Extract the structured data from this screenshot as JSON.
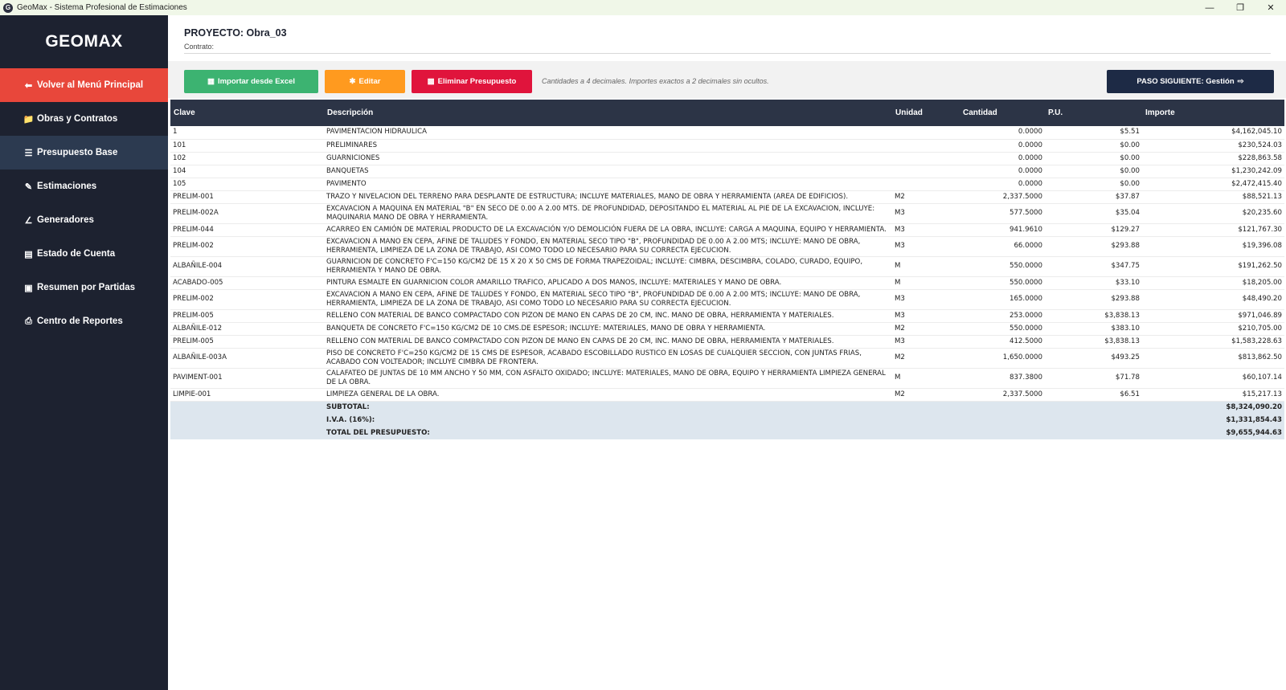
{
  "window": {
    "title": "GeoMax - Sistema Profesional de Estimaciones",
    "icon_letter": "G",
    "minimize_icon": "minimize-icon",
    "maximize_icon": "restore-icon",
    "close_icon": "close-icon"
  },
  "sidebar": {
    "brand": "GEOMAX",
    "back_label": "Volver al Menú Principal",
    "items": [
      {
        "label": "Obras y Contratos",
        "icon": "folder-icon"
      },
      {
        "label": "Presupuesto Base",
        "icon": "list-icon"
      },
      {
        "label": "Estimaciones",
        "icon": "edit-doc-icon"
      },
      {
        "label": "Generadores",
        "icon": "ruler-icon"
      },
      {
        "label": "Estado de Cuenta",
        "icon": "ledger-icon"
      },
      {
        "label": "Resumen por Partidas",
        "icon": "book-icon"
      },
      {
        "label": "Centro de Reportes",
        "icon": "printer-icon"
      }
    ],
    "active_index": 1
  },
  "header": {
    "project": "PROYECTO: Obra_03",
    "contract": "Contrato:"
  },
  "toolbar": {
    "import_label": "Importar desde Excel",
    "edit_label": "Editar",
    "delete_label": "Eliminar Presupuesto",
    "note": "Cantidades a 4 decimales. Importes exactos a 2 decimales sin ocultos.",
    "next_label": "PASO SIGUIENTE: Gestión"
  },
  "colors": {
    "sidebar_bg": "#1d2230",
    "back_button": "#e8473b",
    "active_item": "#2c3a50",
    "import_button": "#3cb371",
    "edit_button": "#ff9a1f",
    "delete_button": "#e0143c",
    "next_button": "#1d2a45",
    "table_header": "#2c3446",
    "totals_bg": "#dde6ee"
  },
  "table": {
    "headers": [
      "Clave",
      "Descripción",
      "Unidad",
      "Cantidad",
      "P.U.",
      "Importe"
    ],
    "rows": [
      [
        "1",
        "PAVIMENTACION HIDRAULICA",
        "",
        "0.0000",
        "$5.51",
        "$4,162,045.10"
      ],
      [
        "101",
        "PRELIMINARES",
        "",
        "0.0000",
        "$0.00",
        "$230,524.03"
      ],
      [
        "102",
        "GUARNICIONES",
        "",
        "0.0000",
        "$0.00",
        "$228,863.58"
      ],
      [
        "104",
        "BANQUETAS",
        "",
        "0.0000",
        "$0.00",
        "$1,230,242.09"
      ],
      [
        "105",
        "PAVIMENTO",
        "",
        "0.0000",
        "$0.00",
        "$2,472,415.40"
      ],
      [
        "PRELIM-001",
        "TRAZO Y NIVELACION DEL TERRENO PARA DESPLANTE DE ESTRUCTURA; INCLUYE MATERIALES, MANO DE OBRA Y HERRAMIENTA (AREA DE EDIFICIOS).",
        "M2",
        "2,337.5000",
        "$37.87",
        "$88,521.13"
      ],
      [
        "PRELIM-002A",
        "EXCAVACION A MAQUINA EN MATERIAL \"B\" EN SECO DE 0.00 A 2.00 MTS. DE PROFUNDIDAD, DEPOSITANDO EL MATERIAL AL PIE DE LA EXCAVACION, INCLUYE: MAQUINARIA MANO DE OBRA Y HERRAMIENTA.",
        "M3",
        "577.5000",
        "$35.04",
        "$20,235.60"
      ],
      [
        "PRELIM-044",
        "ACARREO EN CAMIÓN DE MATERIAL PRODUCTO DE LA EXCAVACIÓN Y/O DEMOLICIÓN FUERA DE LA OBRA, INCLUYE: CARGA A MAQUINA, EQUIPO Y HERRAMIENTA.",
        "M3",
        "941.9610",
        "$129.27",
        "$121,767.30"
      ],
      [
        "PRELIM-002",
        "EXCAVACION A MANO EN CEPA, AFINE DE TALUDES Y FONDO, EN MATERIAL SECO TIPO \"B\", PROFUNDIDAD DE 0.00 A 2.00 MTS; INCLUYE: MANO DE OBRA, HERRAMIENTA, LIMPIEZA DE LA ZONA DE TRABAJO, ASI COMO TODO LO NECESARIO PARA SU CORRECTA EJECUCION.",
        "M3",
        "66.0000",
        "$293.88",
        "$19,396.08"
      ],
      [
        "ALBAÑILE-004",
        "GUARNICION DE CONCRETO F'C=150 KG/CM2 DE 15 X 20 X 50 CMS DE FORMA TRAPEZOIDAL; INCLUYE: CIMBRA, DESCIMBRA, COLADO, CURADO, EQUIPO, HERRAMIENTA Y MANO DE OBRA.",
        "M",
        "550.0000",
        "$347.75",
        "$191,262.50"
      ],
      [
        "ACABADO-005",
        "PINTURA ESMALTE EN GUARNICION COLOR AMARILLO TRAFICO, APLICADO A DOS MANOS, INCLUYE: MATERIALES Y MANO DE OBRA.",
        "M",
        "550.0000",
        "$33.10",
        "$18,205.00"
      ],
      [
        "PRELIM-002",
        "EXCAVACION A MANO EN CEPA, AFINE DE TALUDES Y FONDO, EN MATERIAL SECO TIPO \"B\", PROFUNDIDAD DE 0.00 A 2.00 MTS; INCLUYE: MANO DE OBRA, HERRAMIENTA, LIMPIEZA DE LA ZONA DE TRABAJO, ASI COMO TODO LO NECESARIO PARA SU CORRECTA EJECUCION.",
        "M3",
        "165.0000",
        "$293.88",
        "$48,490.20"
      ],
      [
        "PRELIM-005",
        "RELLENO CON MATERIAL DE BANCO COMPACTADO CON PIZON DE MANO EN CAPAS DE 20 CM, INC. MANO DE OBRA, HERRAMIENTA Y MATERIALES.",
        "M3",
        "253.0000",
        "$3,838.13",
        "$971,046.89"
      ],
      [
        "ALBAÑILE-012",
        "BANQUETA DE CONCRETO F'C=150 KG/CM2 DE 10 CMS.DE ESPESOR; INCLUYE: MATERIALES, MANO DE OBRA Y HERRAMIENTA.",
        "M2",
        "550.0000",
        "$383.10",
        "$210,705.00"
      ],
      [
        "PRELIM-005",
        "RELLENO CON MATERIAL DE BANCO COMPACTADO CON PIZON DE MANO EN CAPAS DE 20 CM, INC. MANO DE OBRA, HERRAMIENTA Y MATERIALES.",
        "M3",
        "412.5000",
        "$3,838.13",
        "$1,583,228.63"
      ],
      [
        "ALBAÑILE-003A",
        "PISO DE CONCRETO F'C=250 KG/CM2 DE 15 CMS DE ESPESOR, ACABADO ESCOBILLADO RUSTICO EN LOSAS DE CUALQUIER SECCION, CON JUNTAS FRIAS, ACABADO CON VOLTEADOR; INCLUYE CIMBRA DE FRONTERA.",
        "M2",
        "1,650.0000",
        "$493.25",
        "$813,862.50"
      ],
      [
        "PAVIMENT-001",
        "CALAFATEO DE JUNTAS DE 10 MM ANCHO Y 50 MM, CON ASFALTO OXIDADO; INCLUYE: MATERIALES, MANO DE OBRA, EQUIPO Y HERRAMIENTA LIMPIEZA GENERAL DE LA OBRA.",
        "M",
        "837.3800",
        "$71.78",
        "$60,107.14"
      ],
      [
        "LIMPIE-001",
        "LIMPIEZA GENERAL DE LA OBRA.",
        "M2",
        "2,337.5000",
        "$6.51",
        "$15,217.13"
      ]
    ],
    "totals": [
      {
        "label": "SUBTOTAL:",
        "value": "$8,324,090.20"
      },
      {
        "label": "I.V.A. (16%):",
        "value": "$1,331,854.43"
      },
      {
        "label": "TOTAL DEL PRESUPUESTO:",
        "value": "$9,655,944.63"
      }
    ]
  }
}
